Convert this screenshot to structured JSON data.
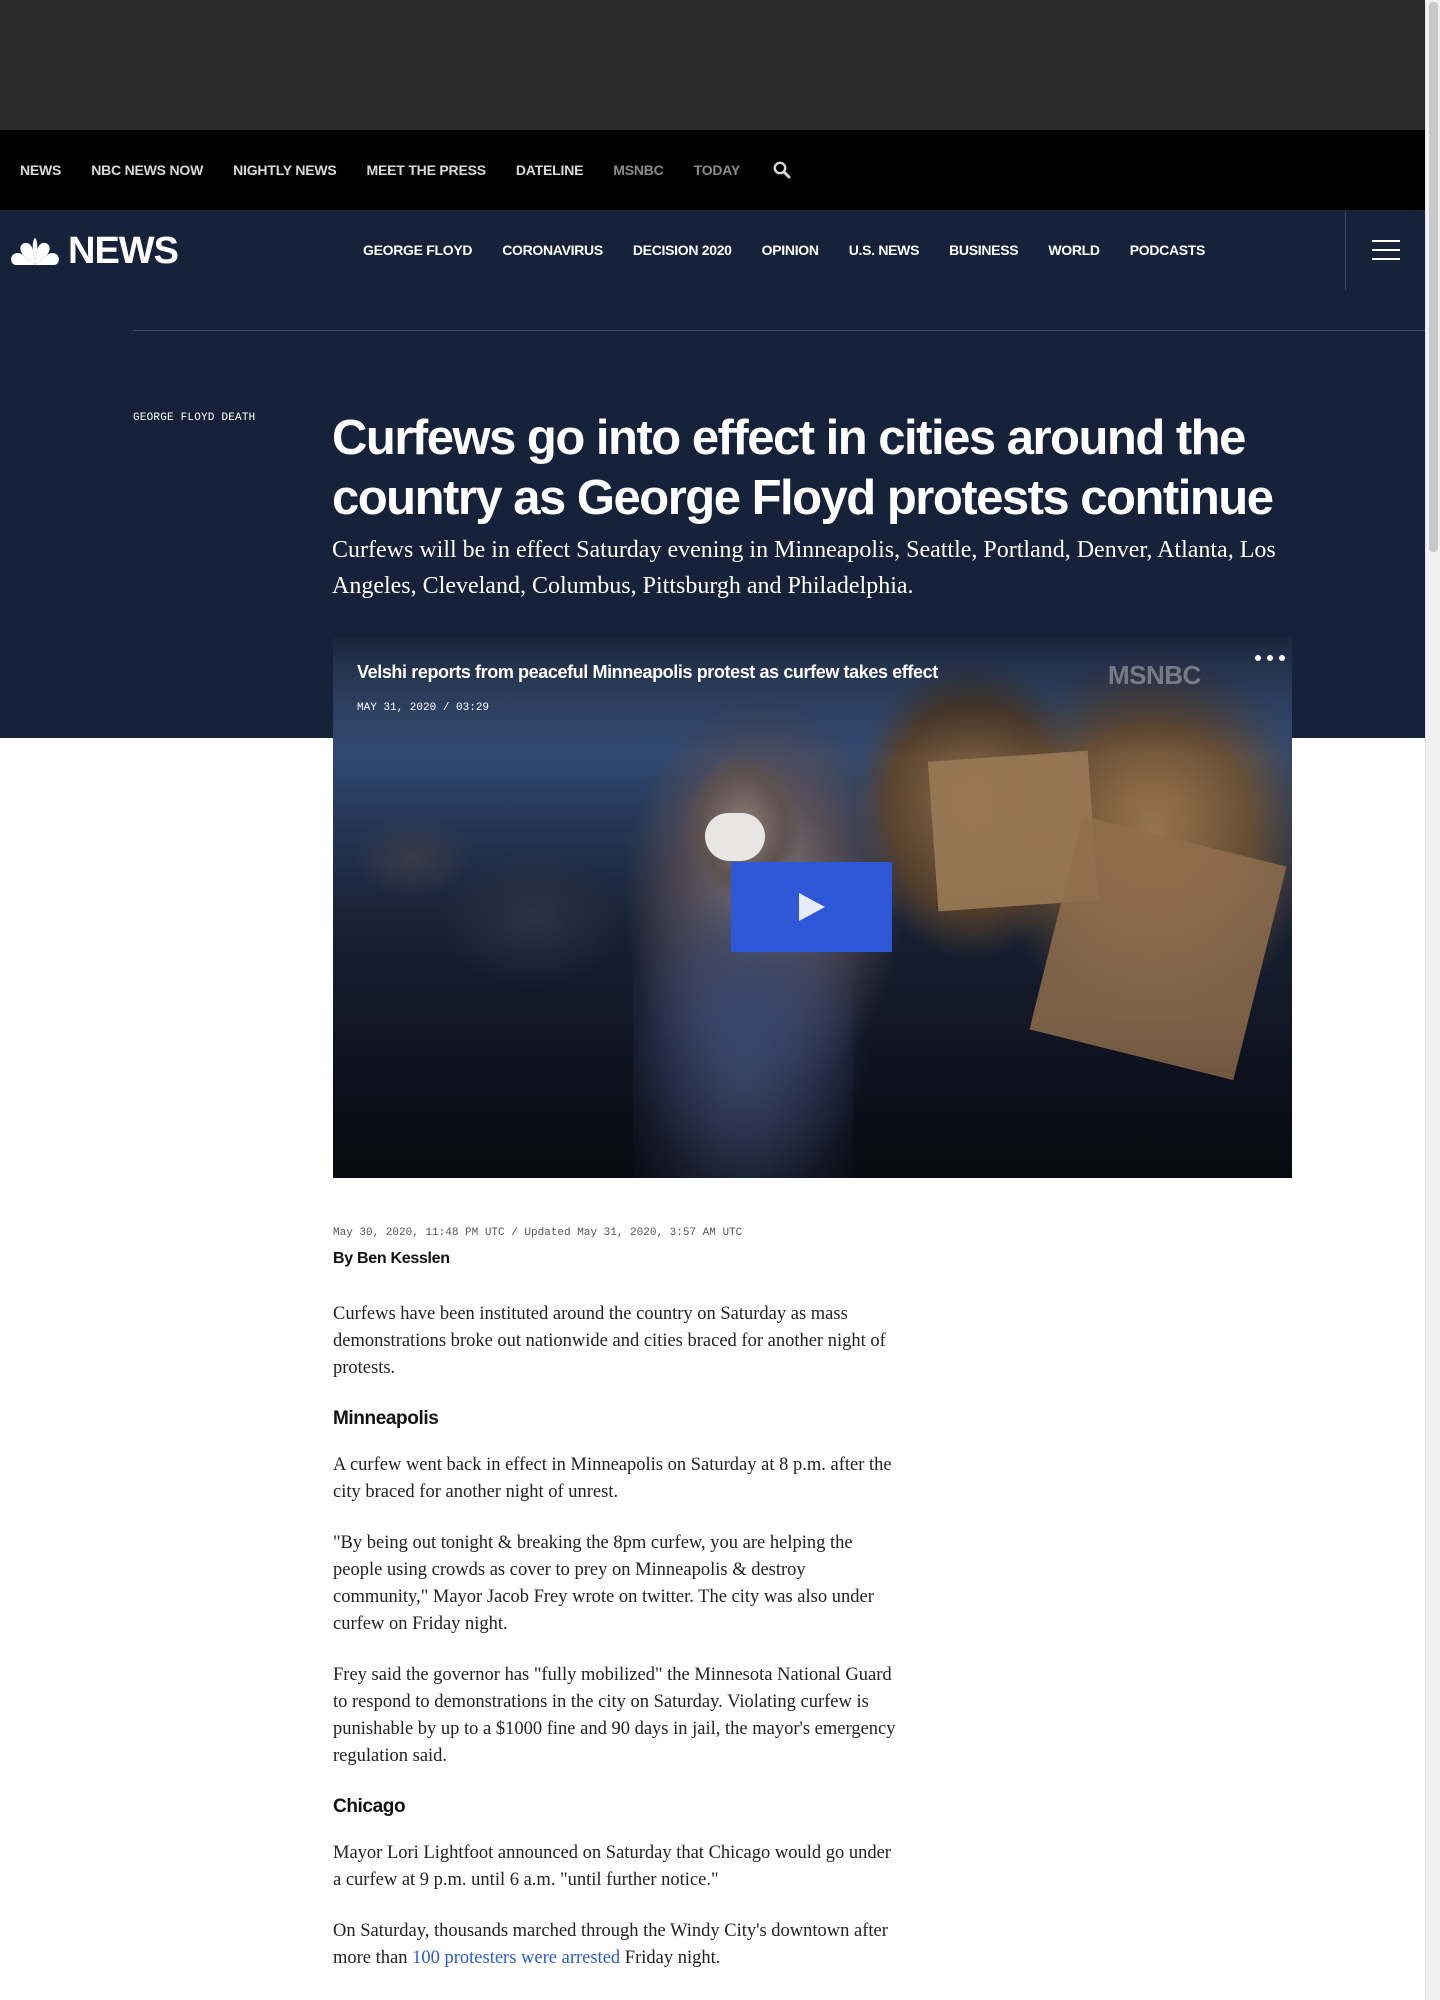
{
  "top_nav": {
    "items": [
      "NEWS",
      "NBC NEWS NOW",
      "NIGHTLY NEWS",
      "MEET THE PRESS",
      "DATELINE",
      "MSNBC",
      "TODAY"
    ]
  },
  "brand": {
    "wordmark": "NEWS"
  },
  "main_nav": {
    "sections": [
      "GEORGE FLOYD",
      "CORONAVIRUS",
      "DECISION 2020",
      "OPINION",
      "U.S. NEWS",
      "BUSINESS",
      "WORLD",
      "PODCASTS"
    ]
  },
  "article": {
    "eyebrow": "GEORGE FLOYD DEATH",
    "headline": "Curfews go into effect in cities around the country as George Floyd protests continue",
    "dek": "Curfews will be in effect Saturday evening in Minneapolis, Seattle, Portland, Denver, Atlanta, Los Angeles, Cleveland, Columbus, Pittsburgh and Philadelphia.",
    "video": {
      "title": "Velshi reports from peaceful Minneapolis protest as curfew takes effect",
      "meta": "MAY 31, 2020 / 03:29",
      "channel": "MSNBC"
    },
    "dateline": "May 30, 2020, 11:48 PM UTC / Updated May 31, 2020, 3:57 AM UTC",
    "byline_prefix": "By",
    "author": "Ben Kesslen",
    "p1": "Curfews have been instituted around the country on Saturday as mass demonstrations broke out nationwide and cities braced for another night of protests.",
    "h_minneapolis": "Minneapolis",
    "p2": "A curfew went back in effect in Minneapolis on Saturday at 8 p.m. after the city braced for another night of unrest.",
    "p3": "\"By being out tonight & breaking the 8pm curfew, you are helping the people using crowds as cover to prey on Minneapolis & destroy community,\" Mayor Jacob Frey wrote on twitter. The city was also under curfew on Friday night.",
    "p4": "Frey said the governor has \"fully mobilized\" the Minnesota National Guard to respond to demonstrations in the city on Saturday. Violating curfew is punishable by up to a $1000 fine and 90 days in jail, the mayor's emergency regulation said.",
    "h_chicago": "Chicago",
    "p5": "Mayor Lori Lightfoot announced on Saturday that Chicago would go under a curfew at 9 p.m. until 6 a.m. \"until further notice.\"",
    "p6_before": "On Saturday, thousands marched through the Windy City's downtown after more than ",
    "p6_link": "100 protesters were arrested",
    "p6_after": " Friday night."
  },
  "colors": {
    "hero_bg": "#15223a",
    "top_nav_bg": "#000000",
    "ad_band_bg": "#2b2b2b",
    "play_button": "#2f58d8",
    "link": "#2a5bd7"
  },
  "icons": [
    "search-icon",
    "nbc-peacock-icon",
    "hamburger-menu-icon",
    "more-options-icon",
    "play-icon"
  ]
}
